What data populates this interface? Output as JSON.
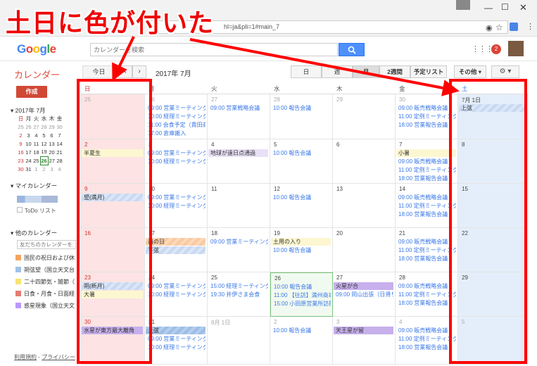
{
  "browser": {
    "url_text": "hl=ja&pli=1#main_7"
  },
  "header": {
    "logo_letters": [
      "G",
      "o",
      "o",
      "g",
      "l",
      "e"
    ],
    "search_placeholder": "カレンダーを検索",
    "search_icon": "search-icon",
    "notification_count": "2"
  },
  "toolbar": {
    "app_title": "カレンダー",
    "today_label": "今日",
    "prev_label": "‹",
    "next_label": "›",
    "month_label": "2017年 7月",
    "view_day": "日",
    "view_week": "週",
    "view_month": "月",
    "view_2weeks": "2週間",
    "view_schedule": "予定リスト",
    "more_label": "その他 ▾",
    "gear_label": "⚙ ▾"
  },
  "sidebar": {
    "create_label": "作成",
    "mini_title": "▾ 2017年 7月",
    "mini_dow": [
      "日",
      "月",
      "火",
      "水",
      "木",
      "金"
    ],
    "mini_weeks": [
      [
        "25",
        "26",
        "27",
        "28",
        "29",
        "30"
      ],
      [
        "2",
        "3",
        "4",
        "5",
        "6",
        "7"
      ],
      [
        "9",
        "10",
        "11",
        "12",
        "13",
        "14"
      ],
      [
        "16",
        "17",
        "18",
        "19",
        "20",
        "21"
      ],
      [
        "23",
        "24",
        "25",
        "26",
        "27",
        "28"
      ],
      [
        "30",
        "31",
        "1",
        "2",
        "3",
        "4"
      ]
    ],
    "mycal_title": "▾ マイカレンダー",
    "todo_label": "ToDo リスト",
    "othercal_title": "▾ 他のカレンダー",
    "friend_placeholder": "友だちのカレンダーを追加",
    "other_calendars": [
      {
        "label": "国民の祝日および休…",
        "color": "#f4a460"
      },
      {
        "label": "朔弦望（国立天文台…",
        "color": "#9fc3e7"
      },
      {
        "label": "二十四節気・雑節（…",
        "color": "#f7e36e"
      },
      {
        "label": "日食・月食・日面経…",
        "color": "#e67c73"
      },
      {
        "label": "惑星現象（国立天文…",
        "color": "#b99aff"
      }
    ],
    "footer_terms": "利用規約",
    "footer_sep": " - ",
    "footer_privacy": "プライバシー"
  },
  "calendar": {
    "dow": [
      "日",
      "月",
      "火",
      "水",
      "木",
      "金",
      "土"
    ],
    "weeks": [
      [
        {
          "d": "25",
          "dim": true,
          "events": []
        },
        {
          "d": "26",
          "dim": true,
          "events": [
            {
              "t": "09:00 営業ミーティング"
            },
            {
              "t": "10:00 経理ミーティング"
            },
            {
              "t": "11:00 会食予定（貴田商事）"
            },
            {
              "t": "17:00 倉庫搬入"
            }
          ]
        },
        {
          "d": "27",
          "dim": true,
          "events": [
            {
              "t": "09:00 営業戦略会議"
            }
          ]
        },
        {
          "d": "28",
          "dim": true,
          "events": [
            {
              "t": "10:00 報告会議"
            }
          ]
        },
        {
          "d": "29",
          "dim": true,
          "events": []
        },
        {
          "d": "30",
          "dim": true,
          "events": [
            {
              "t": "09:00 販売戦略会議"
            },
            {
              "t": "11:00 定例ミーティング"
            },
            {
              "t": "18:00 営業報告会議"
            }
          ]
        },
        {
          "d": "7月 1日",
          "events": [
            {
              "t": "上弦",
              "style": "blue"
            }
          ]
        }
      ],
      [
        {
          "d": "2",
          "red": true,
          "events": [
            {
              "t": "半夏生",
              "style": "yellow"
            }
          ]
        },
        {
          "d": "3",
          "events": [
            {
              "t": "09:00 営業ミーティング"
            },
            {
              "t": "10:00 経理ミーティング"
            }
          ]
        },
        {
          "d": "4",
          "events": [
            {
              "t": "地球が遠日点通過",
              "style": "lpurple"
            }
          ]
        },
        {
          "d": "5",
          "events": [
            {
              "t": "10:00 報告会議"
            }
          ]
        },
        {
          "d": "6",
          "events": []
        },
        {
          "d": "7",
          "events": [
            {
              "t": "小暑",
              "style": "yellow"
            },
            {
              "t": "09:00 販売戦略会議"
            },
            {
              "t": "11:00 定例ミーティング"
            },
            {
              "t": "18:00 営業報告会議"
            }
          ]
        },
        {
          "d": "8",
          "events": []
        }
      ],
      [
        {
          "d": "9",
          "red": true,
          "events": [
            {
              "t": "望(満月)",
              "style": "blue"
            }
          ]
        },
        {
          "d": "10",
          "events": [
            {
              "t": "09:00 営業ミーティング"
            },
            {
              "t": "10:00 経理ミーティング"
            }
          ]
        },
        {
          "d": "11",
          "events": []
        },
        {
          "d": "12",
          "events": [
            {
              "t": "10:00 報告会議"
            }
          ]
        },
        {
          "d": "13",
          "events": []
        },
        {
          "d": "14",
          "events": [
            {
              "t": "09:00 販売戦略会議"
            },
            {
              "t": "11:00 定例ミーティング"
            },
            {
              "t": "18:00 営業報告会議"
            }
          ]
        },
        {
          "d": "15",
          "events": []
        }
      ],
      [
        {
          "d": "16",
          "red": true,
          "events": []
        },
        {
          "d": "17",
          "events": [
            {
              "t": "海の日",
              "style": "orange"
            },
            {
              "t": "下弦",
              "style": "blue"
            }
          ]
        },
        {
          "d": "18",
          "events": [
            {
              "t": "09:00 営業ミーティング"
            }
          ]
        },
        {
          "d": "19",
          "events": [
            {
              "t": "土用の入り",
              "style": "yellow"
            },
            {
              "t": "10:00 報告会議"
            }
          ]
        },
        {
          "d": "20",
          "events": []
        },
        {
          "d": "21",
          "events": [
            {
              "t": "09:00 販売戦略会議"
            },
            {
              "t": "11:00 定例ミーティング"
            },
            {
              "t": "18:00 営業報告会議"
            }
          ]
        },
        {
          "d": "22",
          "events": []
        }
      ],
      [
        {
          "d": "23",
          "red": true,
          "events": [
            {
              "t": "朔(新月)",
              "style": "blue"
            },
            {
              "t": "大暑",
              "style": "yellow"
            }
          ]
        },
        {
          "d": "24",
          "events": [
            {
              "t": "09:00 営業ミーティング"
            },
            {
              "t": "10:00 経理ミーティング"
            }
          ]
        },
        {
          "d": "25",
          "events": [
            {
              "t": "15:00 経理ミーティング"
            },
            {
              "t": "19:30 井伊さま会食"
            }
          ]
        },
        {
          "d": "26",
          "today": true,
          "events": [
            {
              "t": "10:00 報告会議"
            },
            {
              "t": "11:00 【往訪】満州商事様"
            },
            {
              "t": "15:00 小田原営業所訪問"
            }
          ]
        },
        {
          "d": "27",
          "events": [
            {
              "t": "火星が合",
              "style": "purple"
            },
            {
              "t": "09:00 岡山出張（日帰り）"
            }
          ]
        },
        {
          "d": "28",
          "events": [
            {
              "t": "09:00 販売戦略会議"
            },
            {
              "t": "11:00 定例ミーティング"
            },
            {
              "t": "18:00 営業報告会議"
            }
          ]
        },
        {
          "d": "29",
          "events": []
        }
      ],
      [
        {
          "d": "30",
          "red": true,
          "events": [
            {
              "t": "水星が東方最大離角",
              "style": "purple"
            }
          ]
        },
        {
          "d": "31",
          "events": [
            {
              "t": "上弦",
              "style": "hblue"
            },
            {
              "t": "09:00 営業ミーティング"
            },
            {
              "t": "10:00 経理ミーティング"
            }
          ]
        },
        {
          "d": "8月 1日",
          "dim": true,
          "events": []
        },
        {
          "d": "2",
          "dim": true,
          "events": [
            {
              "t": "10:00 報告会議"
            }
          ]
        },
        {
          "d": "3",
          "dim": true,
          "events": [
            {
              "t": "天王星が留",
              "style": "purple"
            }
          ]
        },
        {
          "d": "4",
          "dim": true,
          "events": [
            {
              "t": "09:00 販売戦略会議"
            },
            {
              "t": "11:00 定例ミーティング"
            },
            {
              "t": "18:00 営業報告会議"
            }
          ]
        },
        {
          "d": "5",
          "dim": true,
          "events": []
        }
      ]
    ]
  },
  "annotation": {
    "headline": "土日に色が付いた"
  }
}
